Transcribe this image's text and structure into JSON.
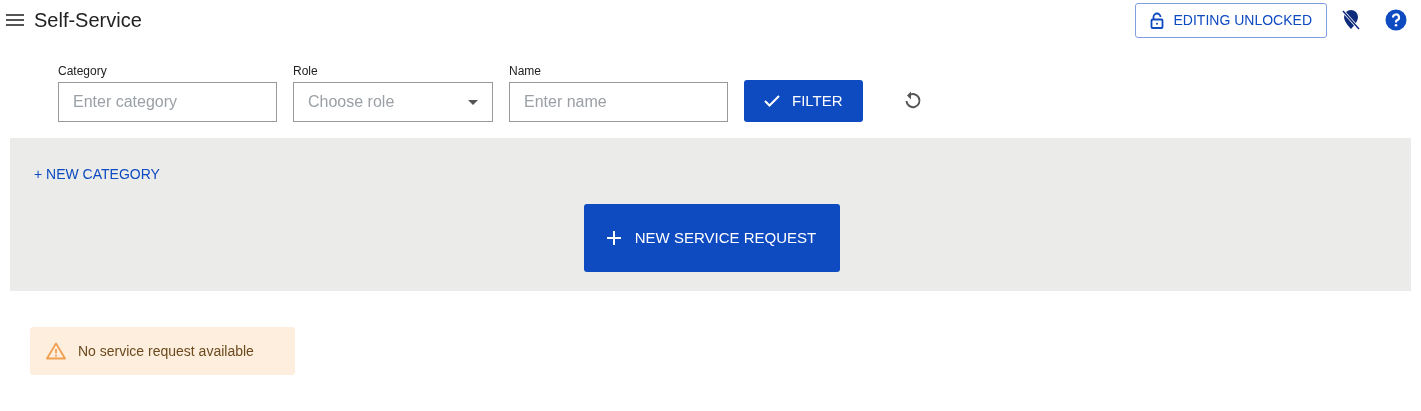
{
  "header": {
    "title": "Self-Service",
    "editing": {
      "label": "EDITING UNLOCKED",
      "locked": false
    }
  },
  "filters": [
    {
      "kind": "text",
      "label": "Category",
      "placeholder": "Enter category"
    },
    {
      "kind": "select",
      "label": "Role",
      "placeholder": "Choose role"
    },
    {
      "kind": "text",
      "label": "Name",
      "placeholder": "Enter name"
    }
  ],
  "filter_button": "FILTER",
  "panel": {
    "new_category": "+ NEW CATEGORY",
    "new_request": "NEW SERVICE REQUEST"
  },
  "alert": {
    "kind": "warning",
    "text": "No service request available"
  }
}
